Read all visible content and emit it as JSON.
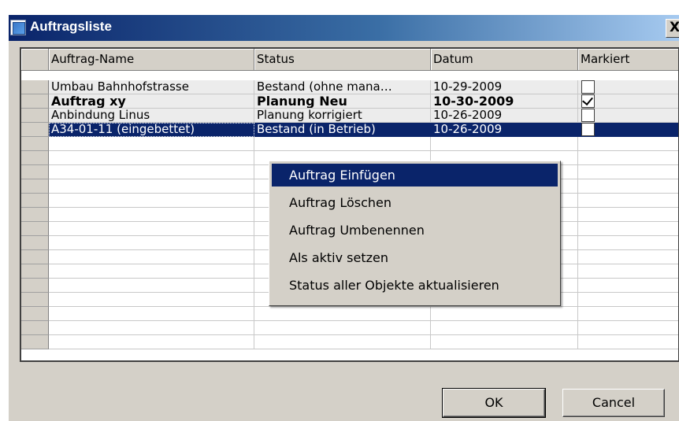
{
  "window": {
    "title": "Auftragsliste",
    "close_label": "X"
  },
  "grid": {
    "columns": [
      "Auftrag-Name",
      "Status",
      "Datum",
      "Markiert"
    ],
    "rows": [
      {
        "name": "Umbau Bahnhofstrasse",
        "status": "Bestand (ohne mana…",
        "date": "10-29-2009",
        "marked": false,
        "bold": false,
        "selected": false
      },
      {
        "name": "Auftrag xy",
        "status": "Planung Neu",
        "date": "10-30-2009",
        "marked": true,
        "bold": true,
        "selected": false
      },
      {
        "name": "Anbindung Linus",
        "status": "Planung korrigiert",
        "date": "10-26-2009",
        "marked": false,
        "bold": false,
        "selected": false
      },
      {
        "name": "A34-01-11 (eingebettet)",
        "status": "Bestand (in Betrieb)",
        "date": "10-26-2009",
        "marked": false,
        "bold": false,
        "selected": true
      }
    ]
  },
  "context_menu": {
    "items": [
      "Auftrag Einfügen",
      "Auftrag Löschen",
      "Auftrag Umbenennen",
      "Als aktiv setzen",
      "Status aller Objekte aktualisieren"
    ],
    "highlighted_index": 0
  },
  "buttons": {
    "ok": "OK",
    "cancel": "Cancel"
  },
  "colors": {
    "title_gradient_start": "#0a246a",
    "title_gradient_end": "#a6caf0",
    "selection": "#0a246a",
    "dialog_face": "#d4d0c8"
  }
}
